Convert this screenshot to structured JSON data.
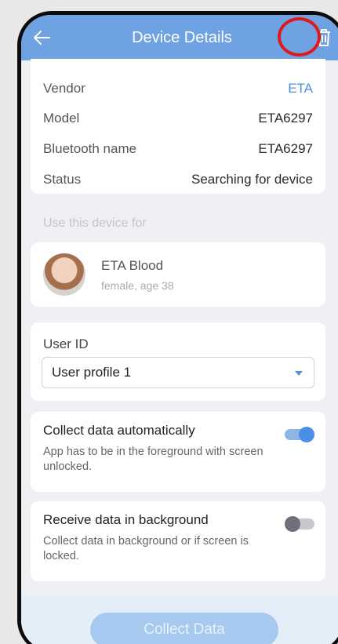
{
  "header": {
    "title": "Device Details",
    "back_icon": "arrow-left-icon",
    "trash_icon": "trash-icon",
    "color": "#6ea2e2"
  },
  "device_info": {
    "rows": [
      {
        "label": "Vendor",
        "value": "ETA"
      },
      {
        "label": "Model",
        "value": "ETA6297"
      },
      {
        "label": "Bluetooth name",
        "value": "ETA6297"
      },
      {
        "label": "Status",
        "value": "Searching for device"
      }
    ]
  },
  "use_for": {
    "label": "Use this device for",
    "user_name": "ETA Blood",
    "user_sub": "female, age 38"
  },
  "user_id": {
    "label": "User ID",
    "selected": "User profile 1"
  },
  "toggles": [
    {
      "title": "Collect data automatically",
      "description": "App has to be in the foreground with screen unlocked.",
      "state": "on"
    },
    {
      "title": "Receive data in background",
      "description": "Collect data in background or if screen is locked.",
      "state": "off"
    }
  ],
  "footer": {
    "collect_label": "Collect Data"
  },
  "colors": {
    "accent": "#4a90e2",
    "highlight": "#e01a1a"
  }
}
